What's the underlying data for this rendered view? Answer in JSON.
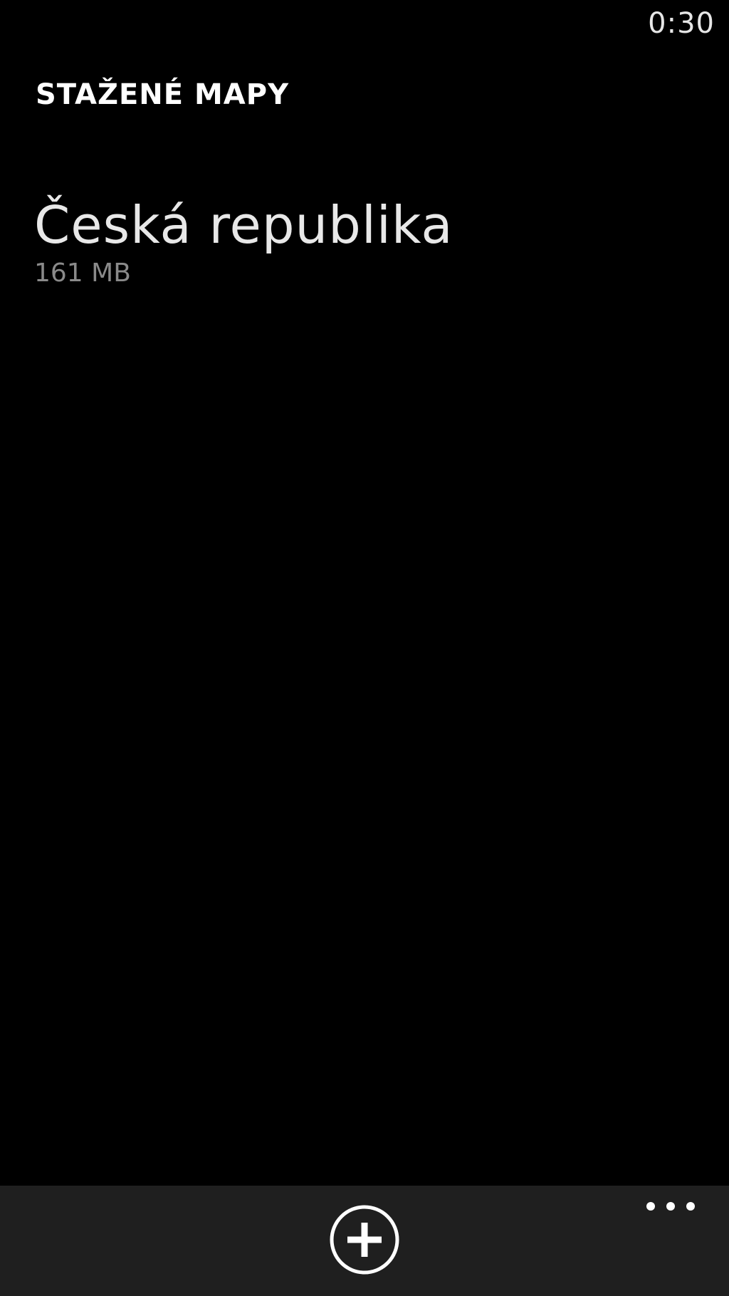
{
  "status_bar": {
    "time": "0:30"
  },
  "header": {
    "title": "STAŽENÉ MAPY"
  },
  "maps": [
    {
      "name": "Česká republika",
      "size": "161 MB"
    }
  ],
  "app_bar": {
    "add_icon": "plus-circle-icon",
    "more_icon": "ellipsis-icon"
  },
  "colors": {
    "background": "#000000",
    "app_bar": "#1f1f1f",
    "text_primary": "#ffffff",
    "text_secondary": "#8a8a8a"
  }
}
